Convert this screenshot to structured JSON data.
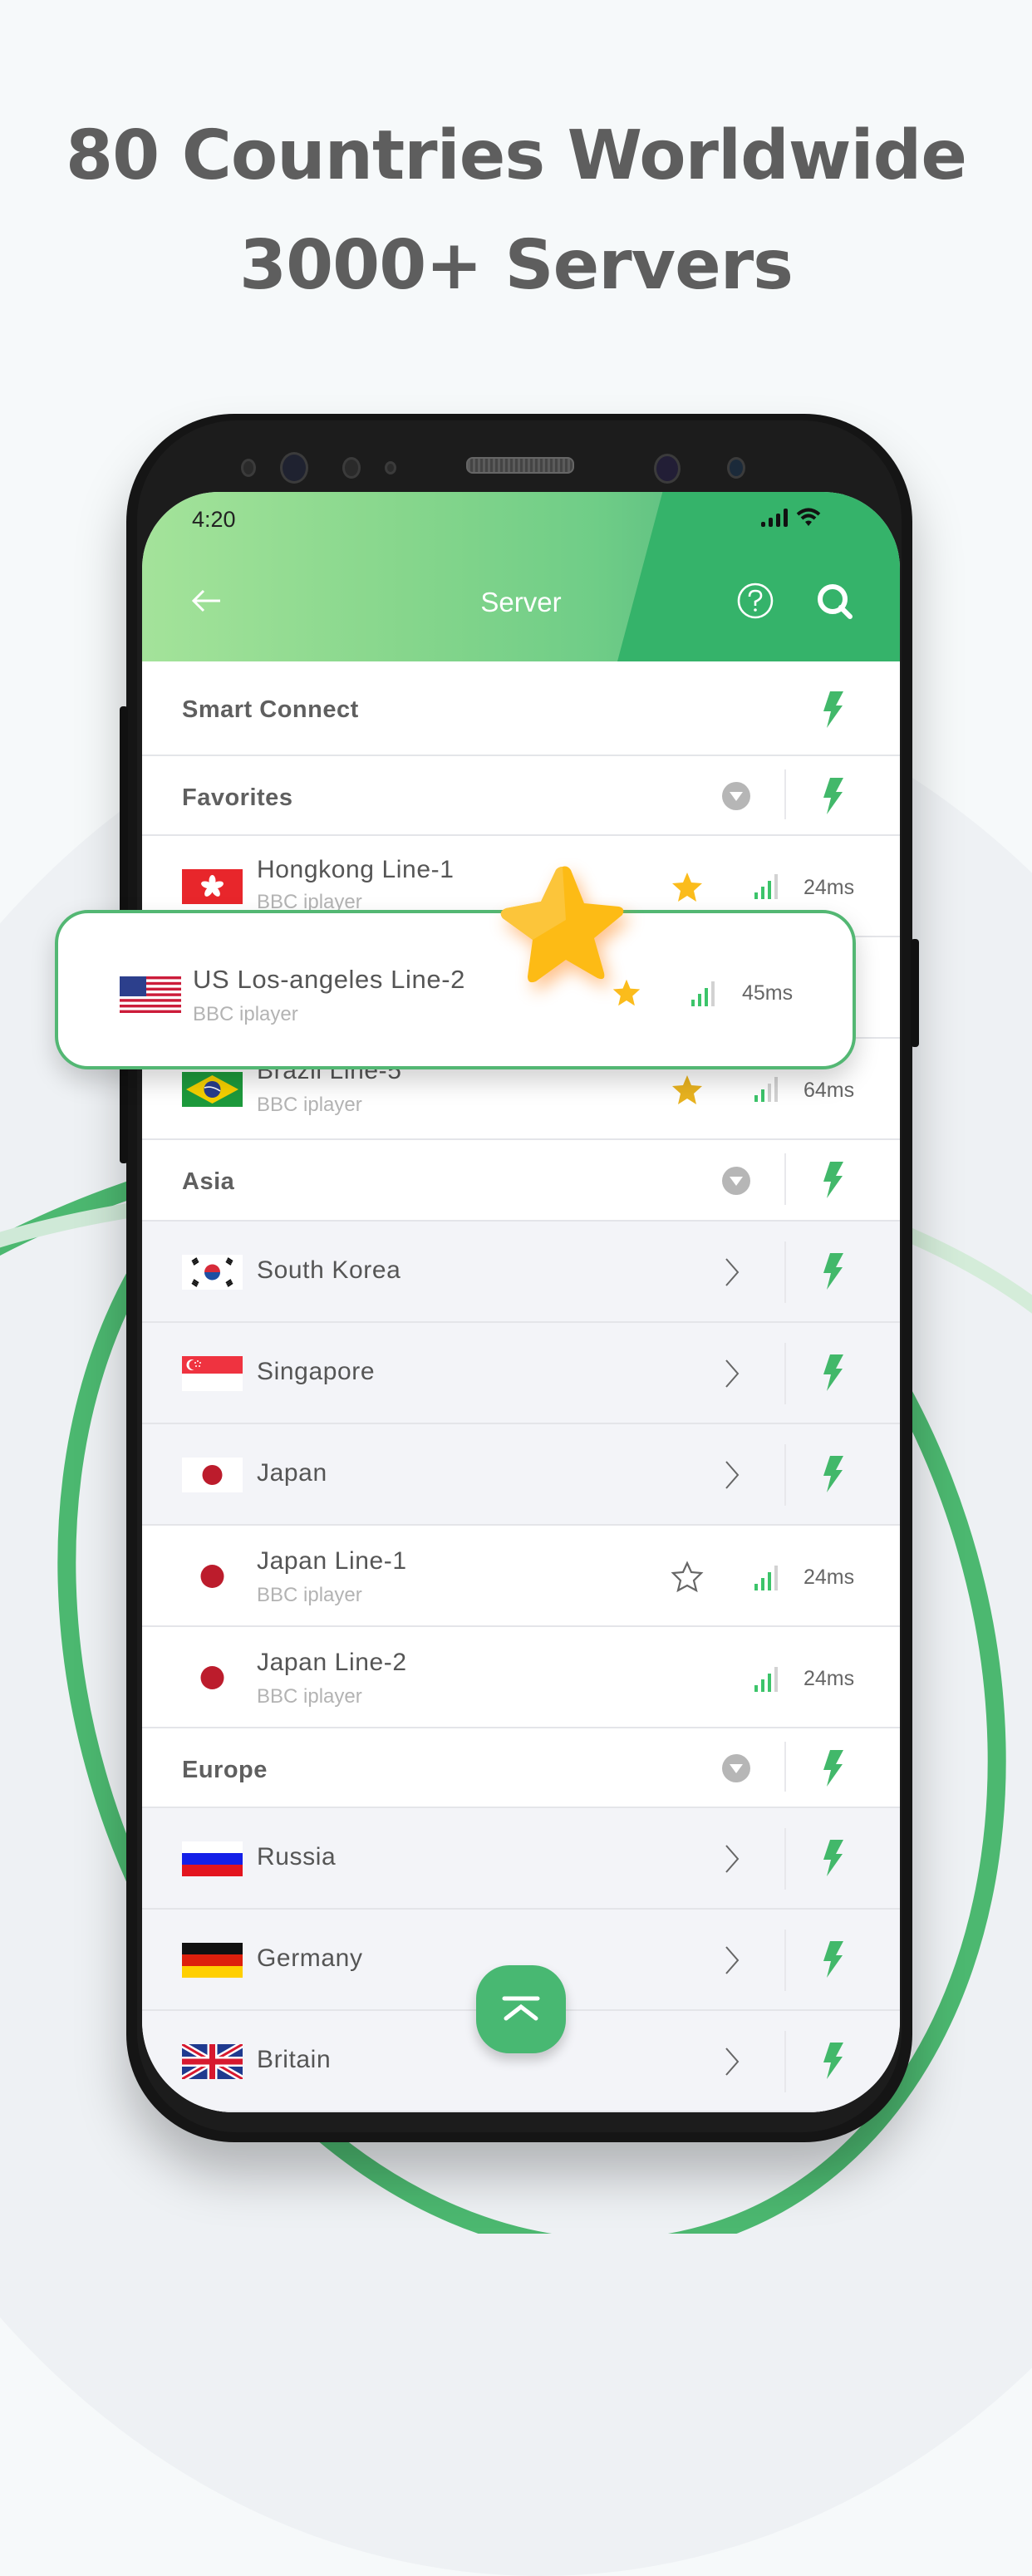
{
  "headline": {
    "line1": "80 Countries Worldwide",
    "line2": "3000+ Servers"
  },
  "colors": {
    "accent_green": "#48b872",
    "header_dark_green": "#35b36a",
    "star_gold": "#fbbc1c",
    "text_grey": "#5e5e5e"
  },
  "status_bar": {
    "time": "4:20",
    "icons": [
      "cellular-signal-icon",
      "wifi-icon"
    ]
  },
  "app_bar": {
    "title": "Server",
    "back_icon": "arrow-left-icon",
    "help_icon": "question-circle-icon",
    "search_icon": "search-icon"
  },
  "smart_connect": {
    "label": "Smart Connect",
    "icon": "bolt-icon"
  },
  "sections": {
    "favorites": {
      "label": "Favorites",
      "items": [
        {
          "flag": "hongkong",
          "name": "Hongkong Line-1",
          "sub": "BBC iplayer",
          "favorite": true,
          "ping": "24ms"
        },
        {
          "flag": "brazil",
          "name": "Brazil Line-5",
          "sub": "BBC iplayer",
          "favorite": true,
          "ping": "64ms"
        }
      ]
    },
    "asia": {
      "label": "Asia",
      "countries": [
        {
          "flag": "south-korea",
          "name": "South Korea"
        },
        {
          "flag": "singapore",
          "name": "Singapore"
        },
        {
          "flag": "japan",
          "name": "Japan"
        }
      ],
      "lines": [
        {
          "name": "Japan Line-1",
          "sub": "BBC iplayer",
          "favorite": false,
          "ping": "24ms"
        },
        {
          "name": "Japan Line-2",
          "sub": "BBC iplayer",
          "ping": "24ms"
        }
      ]
    },
    "europe": {
      "label": "Europe",
      "countries": [
        {
          "flag": "russia",
          "name": "Russia"
        },
        {
          "flag": "germany",
          "name": "Germany"
        },
        {
          "flag": "britain",
          "name": "Britain"
        }
      ]
    }
  },
  "popup": {
    "flag": "usa",
    "name": "US Los-angeles Line-2",
    "sub": "BBC iplayer",
    "favorite": true,
    "ping": "45ms"
  },
  "fab": {
    "icon": "scroll-to-top-icon"
  }
}
